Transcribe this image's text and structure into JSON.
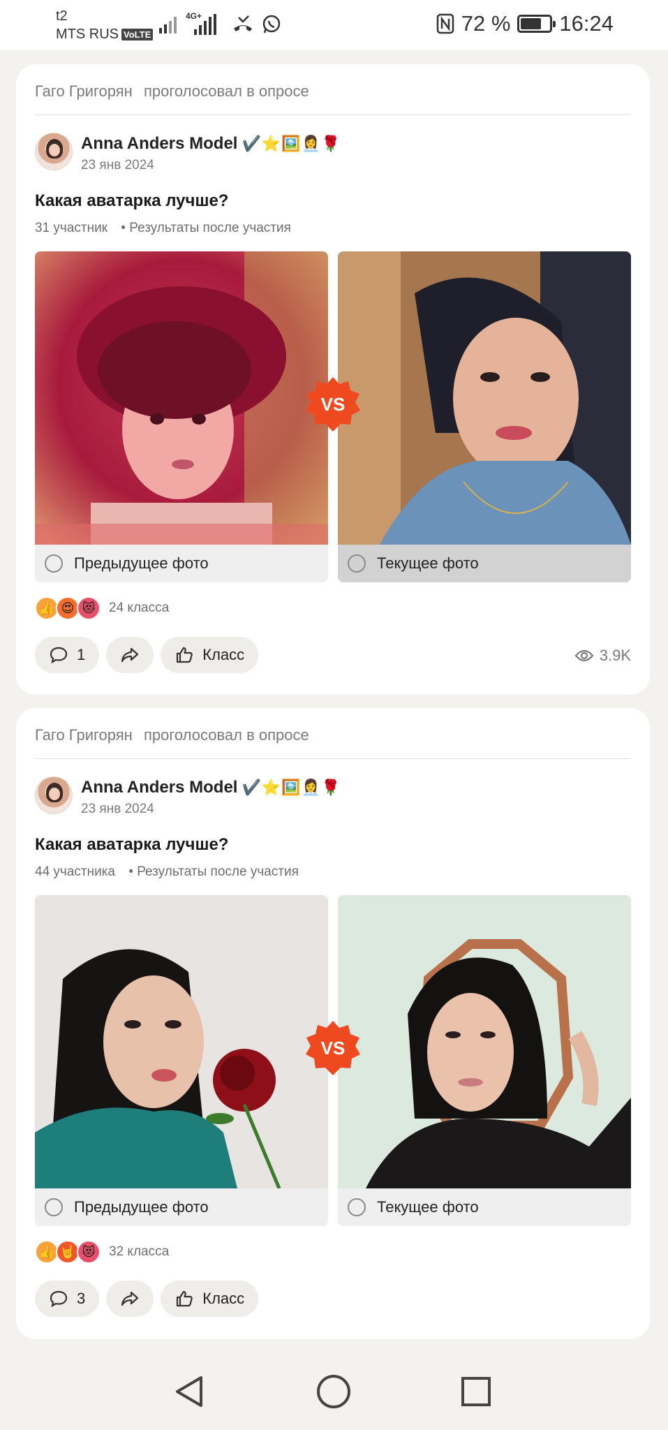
{
  "status_bar": {
    "carrier_1": "t2",
    "carrier_2": "MTS RUS",
    "volte": "VoLTE",
    "network": "4G+",
    "battery": "72 %",
    "battery_level": 0.72,
    "time": "16:24"
  },
  "posts": [
    {
      "voter_name": "Гаго Григорян",
      "voter_action": "проголосовал в опросе",
      "author": "Anna Anders Model",
      "author_badges": "✔️⭐🖼️👩‍💼🌹",
      "date": "23 янв 2024",
      "question": "Какая аватарка лучше?",
      "participants": "31 участник",
      "results_note": "• Результаты после участия",
      "options": [
        {
          "label": "Предыдущее фото",
          "selected": false
        },
        {
          "label": "Текущее фото",
          "selected": true
        }
      ],
      "vs_label": "VS",
      "reactions_count": "24 класса",
      "comments_count": "1",
      "class_label": "Класс",
      "views": "3.9K"
    },
    {
      "voter_name": "Гаго Григорян",
      "voter_action": "проголосовал в опросе",
      "author": "Anna Anders Model",
      "author_badges": "✔️⭐🖼️👩‍💼🌹",
      "date": "23 янв 2024",
      "question": "Какая аватарка лучше?",
      "participants": "44 участника",
      "results_note": "• Результаты после участия",
      "options": [
        {
          "label": "Предыдущее фото",
          "selected": false
        },
        {
          "label": "Текущее фото",
          "selected": false
        }
      ],
      "vs_label": "VS",
      "reactions_count": "32 класса",
      "comments_count": "3",
      "class_label": "Класс"
    }
  ],
  "nav": {
    "back": "back-icon",
    "home": "home-icon",
    "recents": "recents-icon"
  }
}
